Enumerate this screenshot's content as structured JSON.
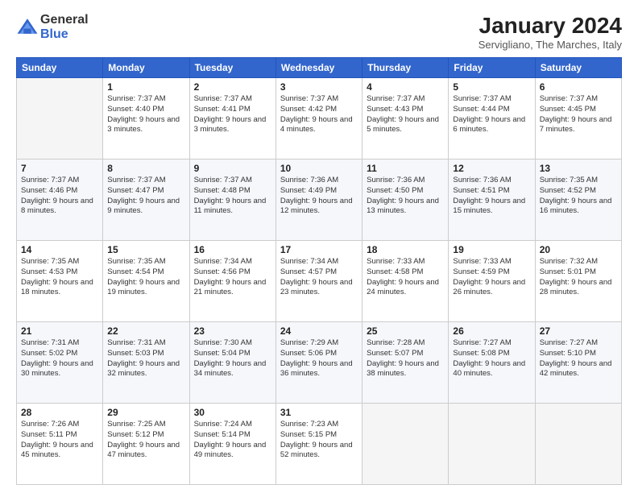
{
  "logo": {
    "general": "General",
    "blue": "Blue"
  },
  "header": {
    "month": "January 2024",
    "location": "Servigliano, The Marches, Italy"
  },
  "weekdays": [
    "Sunday",
    "Monday",
    "Tuesday",
    "Wednesday",
    "Thursday",
    "Friday",
    "Saturday"
  ],
  "weeks": [
    [
      {
        "num": "",
        "sunrise": "",
        "sunset": "",
        "daylight": ""
      },
      {
        "num": "1",
        "sunrise": "Sunrise: 7:37 AM",
        "sunset": "Sunset: 4:40 PM",
        "daylight": "Daylight: 9 hours and 3 minutes."
      },
      {
        "num": "2",
        "sunrise": "Sunrise: 7:37 AM",
        "sunset": "Sunset: 4:41 PM",
        "daylight": "Daylight: 9 hours and 3 minutes."
      },
      {
        "num": "3",
        "sunrise": "Sunrise: 7:37 AM",
        "sunset": "Sunset: 4:42 PM",
        "daylight": "Daylight: 9 hours and 4 minutes."
      },
      {
        "num": "4",
        "sunrise": "Sunrise: 7:37 AM",
        "sunset": "Sunset: 4:43 PM",
        "daylight": "Daylight: 9 hours and 5 minutes."
      },
      {
        "num": "5",
        "sunrise": "Sunrise: 7:37 AM",
        "sunset": "Sunset: 4:44 PM",
        "daylight": "Daylight: 9 hours and 6 minutes."
      },
      {
        "num": "6",
        "sunrise": "Sunrise: 7:37 AM",
        "sunset": "Sunset: 4:45 PM",
        "daylight": "Daylight: 9 hours and 7 minutes."
      }
    ],
    [
      {
        "num": "7",
        "sunrise": "Sunrise: 7:37 AM",
        "sunset": "Sunset: 4:46 PM",
        "daylight": "Daylight: 9 hours and 8 minutes."
      },
      {
        "num": "8",
        "sunrise": "Sunrise: 7:37 AM",
        "sunset": "Sunset: 4:47 PM",
        "daylight": "Daylight: 9 hours and 9 minutes."
      },
      {
        "num": "9",
        "sunrise": "Sunrise: 7:37 AM",
        "sunset": "Sunset: 4:48 PM",
        "daylight": "Daylight: 9 hours and 11 minutes."
      },
      {
        "num": "10",
        "sunrise": "Sunrise: 7:36 AM",
        "sunset": "Sunset: 4:49 PM",
        "daylight": "Daylight: 9 hours and 12 minutes."
      },
      {
        "num": "11",
        "sunrise": "Sunrise: 7:36 AM",
        "sunset": "Sunset: 4:50 PM",
        "daylight": "Daylight: 9 hours and 13 minutes."
      },
      {
        "num": "12",
        "sunrise": "Sunrise: 7:36 AM",
        "sunset": "Sunset: 4:51 PM",
        "daylight": "Daylight: 9 hours and 15 minutes."
      },
      {
        "num": "13",
        "sunrise": "Sunrise: 7:35 AM",
        "sunset": "Sunset: 4:52 PM",
        "daylight": "Daylight: 9 hours and 16 minutes."
      }
    ],
    [
      {
        "num": "14",
        "sunrise": "Sunrise: 7:35 AM",
        "sunset": "Sunset: 4:53 PM",
        "daylight": "Daylight: 9 hours and 18 minutes."
      },
      {
        "num": "15",
        "sunrise": "Sunrise: 7:35 AM",
        "sunset": "Sunset: 4:54 PM",
        "daylight": "Daylight: 9 hours and 19 minutes."
      },
      {
        "num": "16",
        "sunrise": "Sunrise: 7:34 AM",
        "sunset": "Sunset: 4:56 PM",
        "daylight": "Daylight: 9 hours and 21 minutes."
      },
      {
        "num": "17",
        "sunrise": "Sunrise: 7:34 AM",
        "sunset": "Sunset: 4:57 PM",
        "daylight": "Daylight: 9 hours and 23 minutes."
      },
      {
        "num": "18",
        "sunrise": "Sunrise: 7:33 AM",
        "sunset": "Sunset: 4:58 PM",
        "daylight": "Daylight: 9 hours and 24 minutes."
      },
      {
        "num": "19",
        "sunrise": "Sunrise: 7:33 AM",
        "sunset": "Sunset: 4:59 PM",
        "daylight": "Daylight: 9 hours and 26 minutes."
      },
      {
        "num": "20",
        "sunrise": "Sunrise: 7:32 AM",
        "sunset": "Sunset: 5:01 PM",
        "daylight": "Daylight: 9 hours and 28 minutes."
      }
    ],
    [
      {
        "num": "21",
        "sunrise": "Sunrise: 7:31 AM",
        "sunset": "Sunset: 5:02 PM",
        "daylight": "Daylight: 9 hours and 30 minutes."
      },
      {
        "num": "22",
        "sunrise": "Sunrise: 7:31 AM",
        "sunset": "Sunset: 5:03 PM",
        "daylight": "Daylight: 9 hours and 32 minutes."
      },
      {
        "num": "23",
        "sunrise": "Sunrise: 7:30 AM",
        "sunset": "Sunset: 5:04 PM",
        "daylight": "Daylight: 9 hours and 34 minutes."
      },
      {
        "num": "24",
        "sunrise": "Sunrise: 7:29 AM",
        "sunset": "Sunset: 5:06 PM",
        "daylight": "Daylight: 9 hours and 36 minutes."
      },
      {
        "num": "25",
        "sunrise": "Sunrise: 7:28 AM",
        "sunset": "Sunset: 5:07 PM",
        "daylight": "Daylight: 9 hours and 38 minutes."
      },
      {
        "num": "26",
        "sunrise": "Sunrise: 7:27 AM",
        "sunset": "Sunset: 5:08 PM",
        "daylight": "Daylight: 9 hours and 40 minutes."
      },
      {
        "num": "27",
        "sunrise": "Sunrise: 7:27 AM",
        "sunset": "Sunset: 5:10 PM",
        "daylight": "Daylight: 9 hours and 42 minutes."
      }
    ],
    [
      {
        "num": "28",
        "sunrise": "Sunrise: 7:26 AM",
        "sunset": "Sunset: 5:11 PM",
        "daylight": "Daylight: 9 hours and 45 minutes."
      },
      {
        "num": "29",
        "sunrise": "Sunrise: 7:25 AM",
        "sunset": "Sunset: 5:12 PM",
        "daylight": "Daylight: 9 hours and 47 minutes."
      },
      {
        "num": "30",
        "sunrise": "Sunrise: 7:24 AM",
        "sunset": "Sunset: 5:14 PM",
        "daylight": "Daylight: 9 hours and 49 minutes."
      },
      {
        "num": "31",
        "sunrise": "Sunrise: 7:23 AM",
        "sunset": "Sunset: 5:15 PM",
        "daylight": "Daylight: 9 hours and 52 minutes."
      },
      {
        "num": "",
        "sunrise": "",
        "sunset": "",
        "daylight": ""
      },
      {
        "num": "",
        "sunrise": "",
        "sunset": "",
        "daylight": ""
      },
      {
        "num": "",
        "sunrise": "",
        "sunset": "",
        "daylight": ""
      }
    ]
  ]
}
